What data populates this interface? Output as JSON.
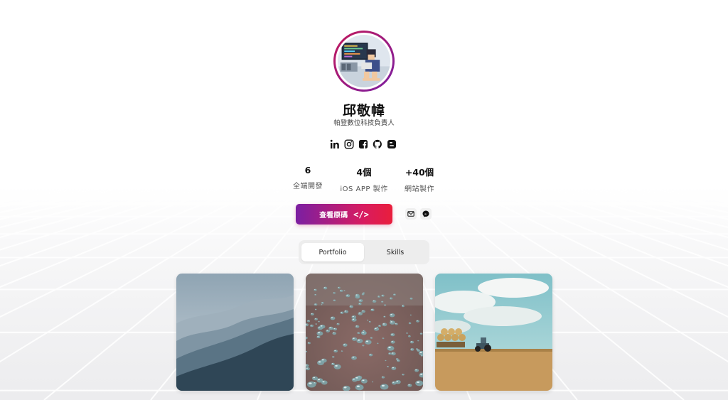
{
  "profile": {
    "name": "邱敬幃",
    "subtitle": "帕登數位科技負責人"
  },
  "socials": [
    {
      "icon": "linkedin-icon"
    },
    {
      "icon": "instagram-icon"
    },
    {
      "icon": "facebook-icon"
    },
    {
      "icon": "github-icon"
    },
    {
      "icon": "blogger-icon"
    }
  ],
  "stats": [
    {
      "value": "6",
      "label": "全端開發"
    },
    {
      "value": "4個",
      "label": "iOS APP 製作"
    },
    {
      "value": "+40個",
      "label": "網站製作"
    }
  ],
  "actions": {
    "primary_label": "查看原碼",
    "primary_icon": "</>",
    "email_icon": "envelope-icon",
    "messenger_icon": "messenger-icon"
  },
  "tabs": [
    {
      "label": "Portfolio",
      "active": true
    },
    {
      "label": "Skills",
      "active": false
    }
  ],
  "portfolio": [
    {
      "image": "misty-mountains"
    },
    {
      "image": "water-droplets"
    },
    {
      "image": "field-tractor"
    }
  ],
  "colors": {
    "accent_start": "#7b1fa2",
    "accent_end": "#e91e3c"
  }
}
